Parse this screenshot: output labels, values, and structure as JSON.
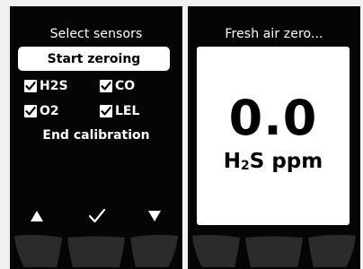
{
  "left_screen": {
    "title": "Select sensors",
    "start_button_label": "Start zeroing",
    "sensors": [
      {
        "label": "H2S",
        "checked": true
      },
      {
        "label": "CO",
        "checked": true
      },
      {
        "label": "O2",
        "checked": true
      },
      {
        "label": "LEL",
        "checked": true
      }
    ],
    "end_calibration_label": "End calibration",
    "softkeys": [
      "up-arrow-icon",
      "check-icon",
      "down-arrow-icon"
    ]
  },
  "right_screen": {
    "title": "Fresh air zero...",
    "reading_value": "0.0",
    "reading_gas_prefix": "H",
    "reading_gas_subscript": "2",
    "reading_gas_suffix": "S",
    "reading_unit": "ppm"
  },
  "colors": {
    "screen_background": "#050505",
    "text": "#ffffff",
    "highlight": "#ffffff",
    "keypad": "#2b2b2b",
    "page_background": "#f1f1f1"
  }
}
